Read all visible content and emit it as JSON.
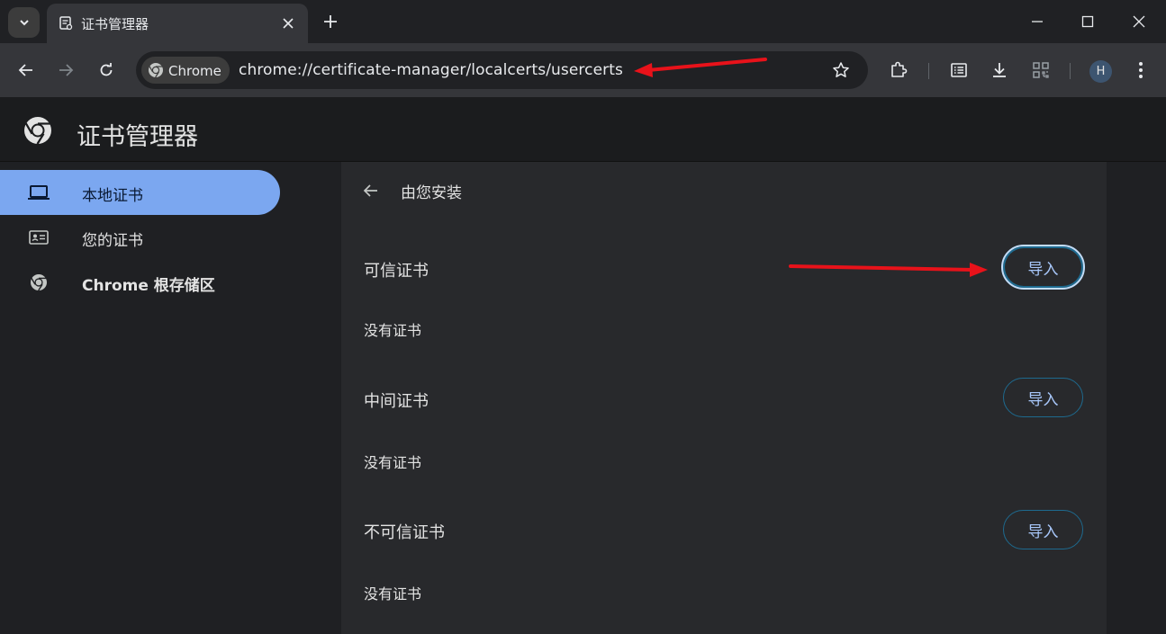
{
  "browser": {
    "tab_title": "证书管理器",
    "omnibox_chip": "Chrome",
    "url": "chrome://certificate-manager/localcerts/usercerts",
    "profile_initial": "H"
  },
  "app": {
    "title": "证书管理器"
  },
  "sidebar": {
    "items": [
      {
        "label": "本地证书",
        "icon": "laptop-icon",
        "active": true
      },
      {
        "label": "您的证书",
        "icon": "id-card-icon",
        "active": false
      },
      {
        "label": "Chrome 根存储区",
        "icon": "chrome-logo-icon",
        "active": false
      }
    ]
  },
  "content": {
    "subpage_title": "由您安装",
    "sections": [
      {
        "title": "可信证书",
        "empty_text": "没有证书",
        "button_label": "导入"
      },
      {
        "title": "中间证书",
        "empty_text": "没有证书",
        "button_label": "导入"
      },
      {
        "title": "不可信证书",
        "empty_text": "没有证书",
        "button_label": "导入"
      }
    ]
  },
  "colors": {
    "accent": "#7ba7f0",
    "annotation_arrow": "#e8121a",
    "button_text": "#a8c7fa"
  }
}
